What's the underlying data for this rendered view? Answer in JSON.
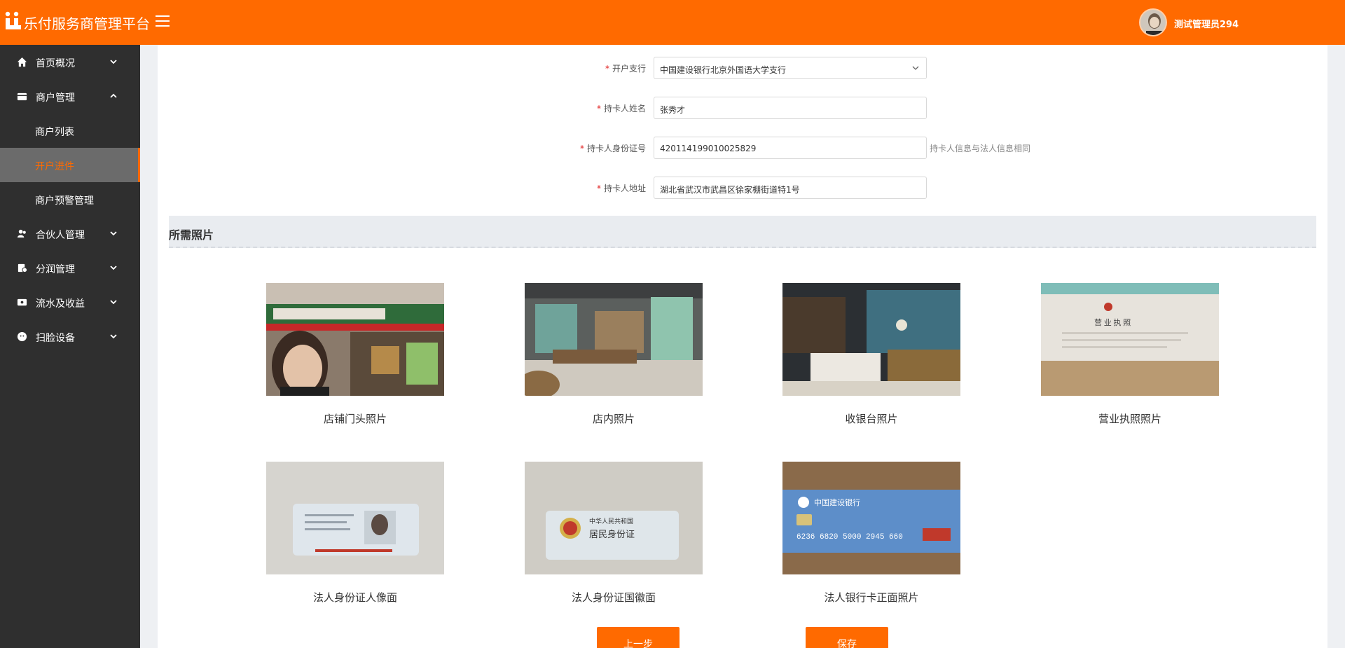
{
  "header": {
    "app_title": "乐付服务商管理平台",
    "user_name": "测试管理员294"
  },
  "sidebar": {
    "items": [
      {
        "label": "首页概况",
        "icon": "home-icon"
      },
      {
        "label": "商户管理",
        "icon": "store-icon"
      },
      {
        "label": "合伙人管理",
        "icon": "partner-icon"
      },
      {
        "label": "分润管理",
        "icon": "profit-icon"
      },
      {
        "label": "流水及收益",
        "icon": "wallet-icon"
      },
      {
        "label": "扫脸设备",
        "icon": "face-scan-icon"
      }
    ],
    "sub_items": [
      {
        "label": "商户列表"
      },
      {
        "label": "开户进件"
      },
      {
        "label": "商户预警管理"
      }
    ],
    "active_sub_item": "开户进件"
  },
  "form": {
    "branch": {
      "label": "开户支行",
      "value": "中国建设银行北京外国语大学支行"
    },
    "holder_name": {
      "label": "持卡人姓名",
      "value": "张秀才"
    },
    "holder_id": {
      "label": "持卡人身份证号",
      "value": "420114199010025829",
      "hint": "持卡人信息与法人信息相同"
    },
    "holder_address": {
      "label": "持卡人地址",
      "value": "湖北省武汉市武昌区徐家棚街道特1号"
    }
  },
  "photos_section": {
    "title": "所需照片",
    "photos": [
      {
        "caption": "店铺门头照片"
      },
      {
        "caption": "店内照片"
      },
      {
        "caption": "收银台照片"
      },
      {
        "caption": "营业执照照片"
      },
      {
        "caption": "法人身份证人像面"
      },
      {
        "caption": "法人身份证国徽面"
      },
      {
        "caption": "法人银行卡正面照片"
      }
    ],
    "photo_text": {
      "license_title": "营 业 执 照",
      "id_front_title": "中华人民共和国",
      "id_front_subtitle": "居民身份证",
      "bank_name": "中国建设银行",
      "card_number": "6236 6820 5000 2945 660"
    }
  },
  "buttons": {
    "prev": "上一步",
    "save": "保存"
  },
  "colors": {
    "accent": "#ff6a00",
    "sidebar_bg": "#2f2f2f",
    "required": "#e02020"
  }
}
